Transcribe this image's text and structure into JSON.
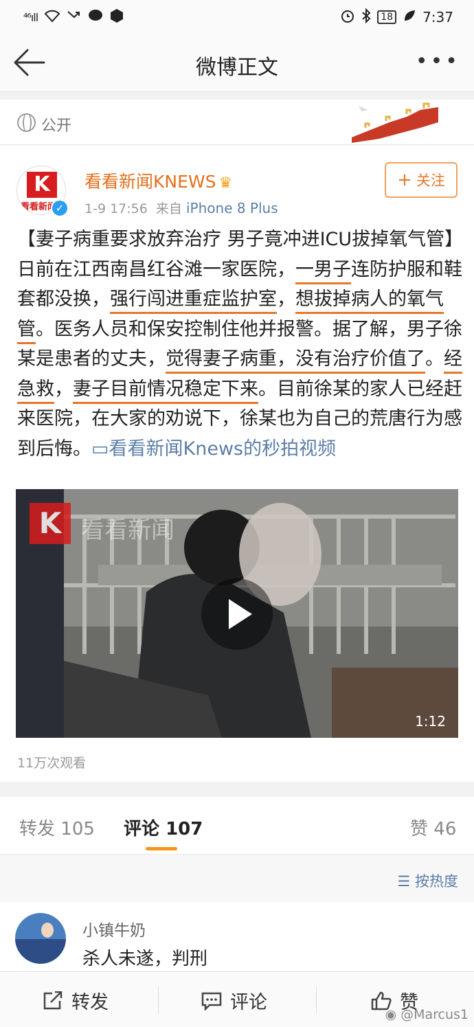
{
  "statusbar": {
    "signal": "⁴⁶ıll",
    "battery": "18",
    "time": "7:37"
  },
  "navbar": {
    "title": "微博正文",
    "more": "•••"
  },
  "visibility": {
    "label": "公开"
  },
  "post": {
    "author": "看看新闻KNEWS",
    "avatar_logo": "K",
    "avatar_caption": "看看新闻",
    "date": "1-9 17:56",
    "source_prefix": "来自",
    "source": "iPhone 8 Plus",
    "follow_label": "关注",
    "text": {
      "p1": "【妻子病重要求放弃治疗 男子竟冲进ICU拔掉氧气管】日前在江西南昌红谷滩一家医院，",
      "h1": "一男子",
      "p2": "连防护服和鞋套都没换，",
      "h2": "强行闯进重症监护室",
      "p3": "，",
      "h3": "想拔掉病人的氧气管",
      "p4": "。医务人员和保安控制住他并报警。据了解，男子徐某是患者的丈夫，",
      "h4": "觉得妻子病重，没有治疗价值了",
      "p5": "。",
      "h5": "经急救",
      "p6": "，",
      "h6": "妻子目前情况稳定下来",
      "p7": "。目前徐某的家人已经赶来医院，在大家的劝说下，徐某也为自己的荒唐行为感到后悔。",
      "link": "看看新闻Knews的秒拍视频"
    },
    "video": {
      "watermark_text": "看看新闻",
      "duration": "1:12"
    },
    "views": "11万次观看"
  },
  "tabs": [
    {
      "label": "转发",
      "count": "105"
    },
    {
      "label": "评论",
      "count": "107"
    },
    {
      "label": "赞",
      "count": "46"
    }
  ],
  "sort_label": "按热度",
  "comments": [
    {
      "user": "小镇牛奶",
      "text": "杀人未遂，判刑"
    }
  ],
  "bottombar": {
    "repost": "转发",
    "comment": "评论",
    "like": "赞"
  },
  "watermark": "@Marcus1"
}
